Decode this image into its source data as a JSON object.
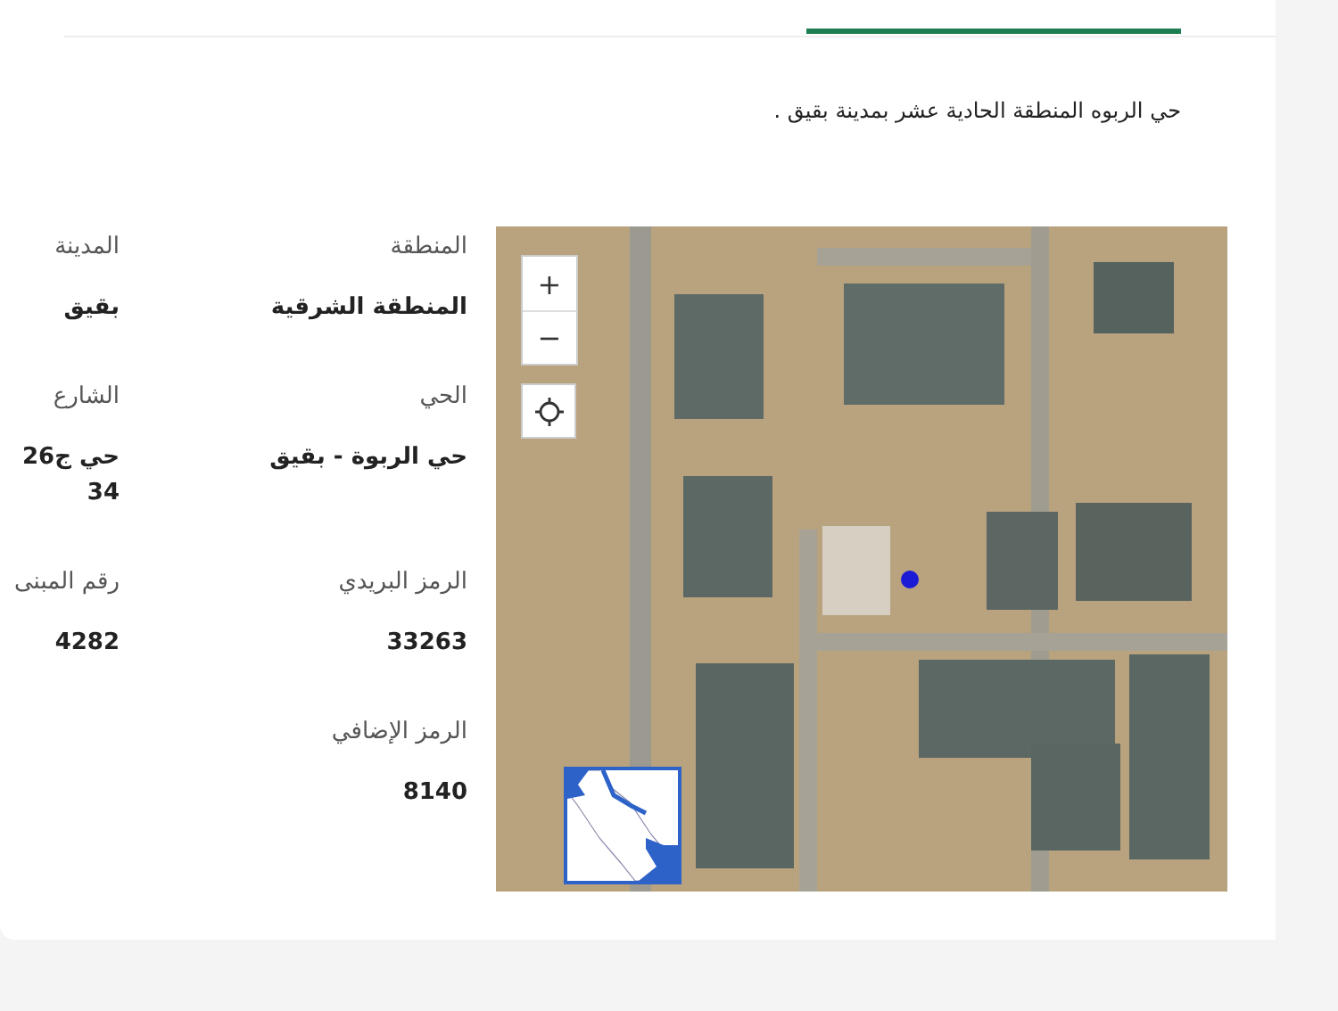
{
  "description": "حي الربوه المنطقة الحادية عشر بمدينة بقيق .",
  "map": {
    "zoom_in": "+",
    "zoom_out": "−"
  },
  "fields": [
    {
      "label": "المنطقة",
      "value": "المنطقة الشرقية"
    },
    {
      "label": "المدينة",
      "value": "بقيق"
    },
    {
      "label": "الحي",
      "value": "حي الربوة - بقيق"
    },
    {
      "label": "الشارع",
      "value": "حي ج26 34"
    },
    {
      "label": "الرمز البريدي",
      "value": "33263"
    },
    {
      "label": "رقم المبنى",
      "value": "4282"
    },
    {
      "label": "الرمز الإضافي",
      "value": "8140"
    }
  ]
}
